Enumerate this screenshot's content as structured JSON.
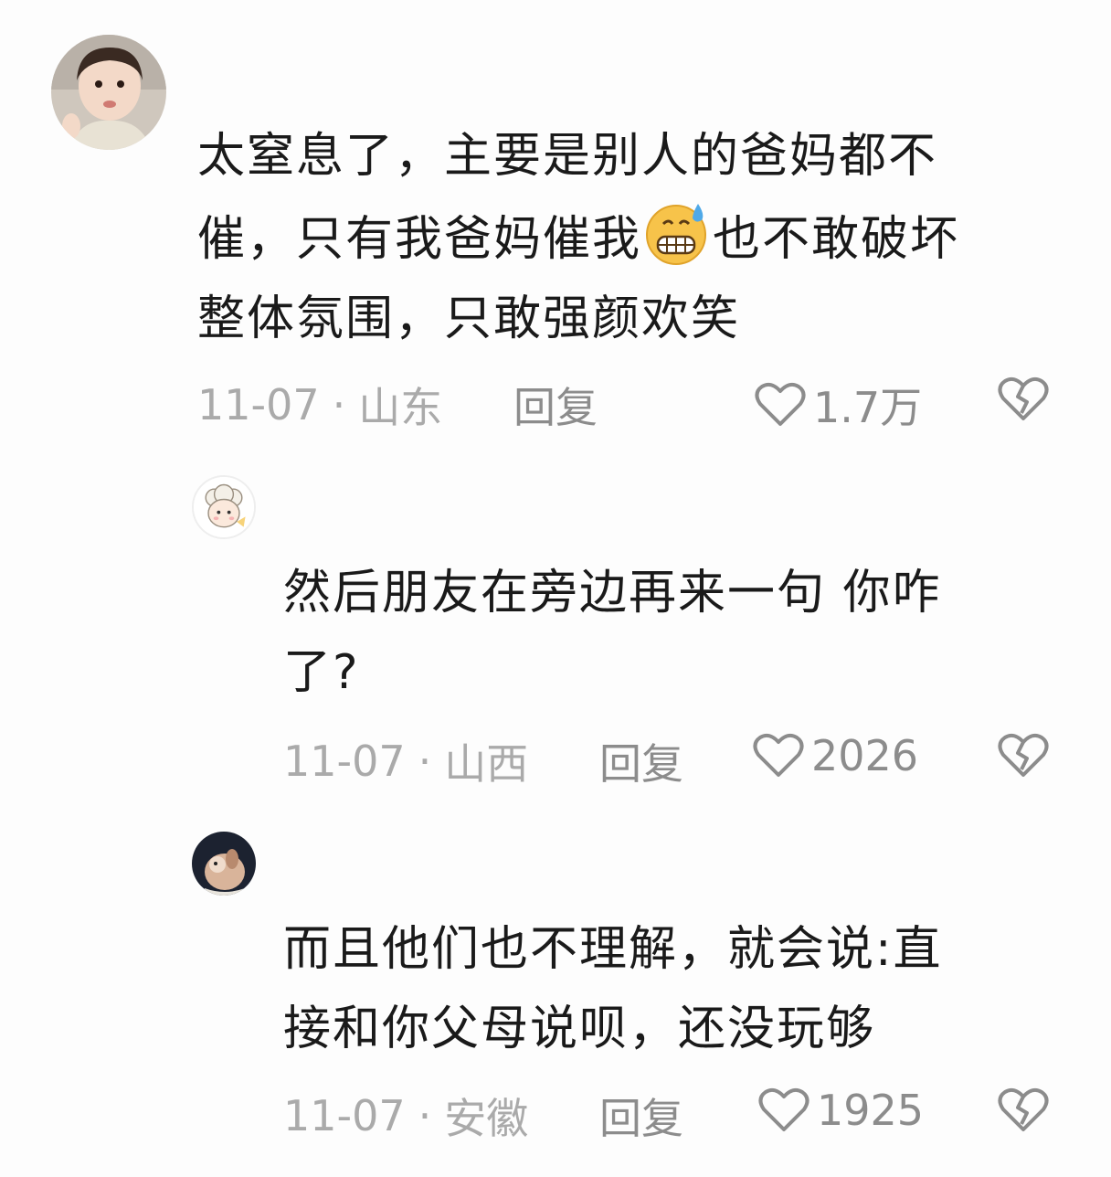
{
  "comments": [
    {
      "text_lines": [
        "太窒息了，主要是别人的爸妈都不",
        "催，只有我爸妈催我",
        "也不敢破坏",
        "整体氛围，只敢强颜欢笑"
      ],
      "emoji": "sweat-grin-emoji",
      "date": "11-07",
      "location": "山东",
      "reply_label": "回复",
      "likes": "1.7万"
    },
    {
      "text_lines": [
        "然后朋友在旁边再来一句 你咋",
        "了?"
      ],
      "date": "11-07",
      "location": "山西",
      "reply_label": "回复",
      "likes": "2026"
    },
    {
      "text_lines": [
        "而且他们也不理解，就会说:直",
        "接和你父母说呗，还没玩够"
      ],
      "date": "11-07",
      "location": "安徽",
      "reply_label": "回复",
      "likes": "1925"
    }
  ],
  "separator": "·",
  "icons": {
    "like": "heart-outline-icon",
    "dislike": "broken-heart-icon"
  }
}
